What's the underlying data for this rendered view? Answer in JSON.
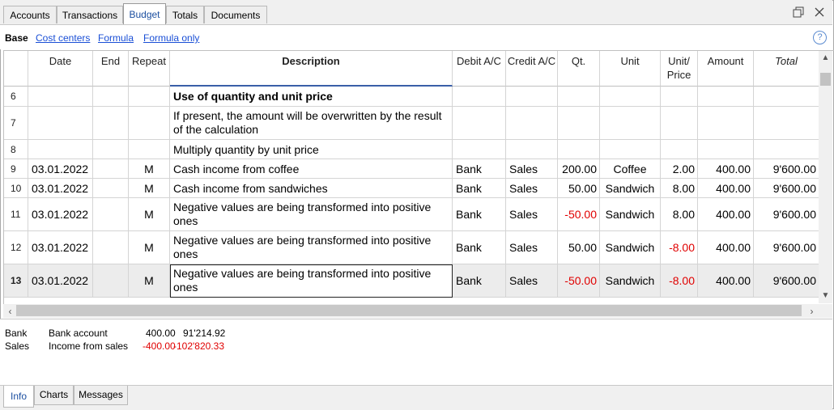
{
  "tabs": {
    "accounts": "Accounts",
    "transactions": "Transactions",
    "budget": "Budget",
    "totals": "Totals",
    "documents": "Documents"
  },
  "views": {
    "base": "Base",
    "cost_centers": "Cost centers",
    "formula": "Formula",
    "formula_only": "Formula only"
  },
  "icons": {
    "restore": "restore-window-icon",
    "close": "close-icon",
    "help": "help-icon"
  },
  "columns": {
    "date": "Date",
    "end": "End",
    "repeat": "Repeat",
    "description": "Description",
    "debit": "Debit A/C",
    "credit": "Credit A/C",
    "qty": "Qt.",
    "unit": "Unit",
    "unit_price": "Unit/ Price",
    "amount": "Amount",
    "total": "Total"
  },
  "rows": [
    {
      "num": "6",
      "date": "",
      "end": "",
      "repeat": "",
      "description": "Use of quantity and unit price",
      "debit": "",
      "credit": "",
      "qty": "",
      "unit": "",
      "unit_price": "",
      "amount": "",
      "total": ""
    },
    {
      "num": "7",
      "date": "",
      "end": "",
      "repeat": "",
      "description": "If present, the amount will be overwritten by the result of the calculation",
      "debit": "",
      "credit": "",
      "qty": "",
      "unit": "",
      "unit_price": "",
      "amount": "",
      "total": ""
    },
    {
      "num": "8",
      "date": "",
      "end": "",
      "repeat": "",
      "description": "Multiply quantity by unit price",
      "debit": "",
      "credit": "",
      "qty": "",
      "unit": "",
      "unit_price": "",
      "amount": "",
      "total": ""
    },
    {
      "num": "9",
      "date": "03.01.2022",
      "end": "",
      "repeat": "M",
      "description": "Cash income from coffee",
      "debit": "Bank",
      "credit": "Sales",
      "qty": "200.00",
      "unit": "Coffee",
      "unit_price": "2.00",
      "amount": "400.00",
      "total": "9'600.00"
    },
    {
      "num": "10",
      "date": "03.01.2022",
      "end": "",
      "repeat": "M",
      "description": "Cash income from sandwiches",
      "debit": "Bank",
      "credit": "Sales",
      "qty": "50.00",
      "unit": "Sandwich",
      "unit_price": "8.00",
      "amount": "400.00",
      "total": "9'600.00"
    },
    {
      "num": "11",
      "date": "03.01.2022",
      "end": "",
      "repeat": "M",
      "description": "Negative values are being transformed into positive ones",
      "debit": "Bank",
      "credit": "Sales",
      "qty": "-50.00",
      "unit": "Sandwich",
      "unit_price": "8.00",
      "amount": "400.00",
      "total": "9'600.00"
    },
    {
      "num": "12",
      "date": "03.01.2022",
      "end": "",
      "repeat": "M",
      "description": "Negative values are being transformed into positive ones",
      "debit": "Bank",
      "credit": "Sales",
      "qty": "50.00",
      "unit": "Sandwich",
      "unit_price": "-8.00",
      "amount": "400.00",
      "total": "9'600.00"
    },
    {
      "num": "13",
      "date": "03.01.2022",
      "end": "",
      "repeat": "M",
      "description": "Negative values are being transformed into positive ones",
      "debit": "Bank",
      "credit": "Sales",
      "qty": "-50.00",
      "unit": "Sandwich",
      "unit_price": "-8.00",
      "amount": "400.00",
      "total": "9'600.00"
    }
  ],
  "info": {
    "line1": {
      "account": "Bank",
      "name": "Bank account",
      "amount": "400.00",
      "balance": "91'214.92"
    },
    "line2": {
      "account": "Sales",
      "name": "Income from sales",
      "amount": "-400.00",
      "balance": "-102'820.33"
    }
  },
  "bottom_tabs": {
    "info": "Info",
    "charts": "Charts",
    "messages": "Messages"
  },
  "colors": {
    "negative": "#e00000",
    "link": "#1a4fd6",
    "active_tab_text": "#1c4fa0"
  }
}
